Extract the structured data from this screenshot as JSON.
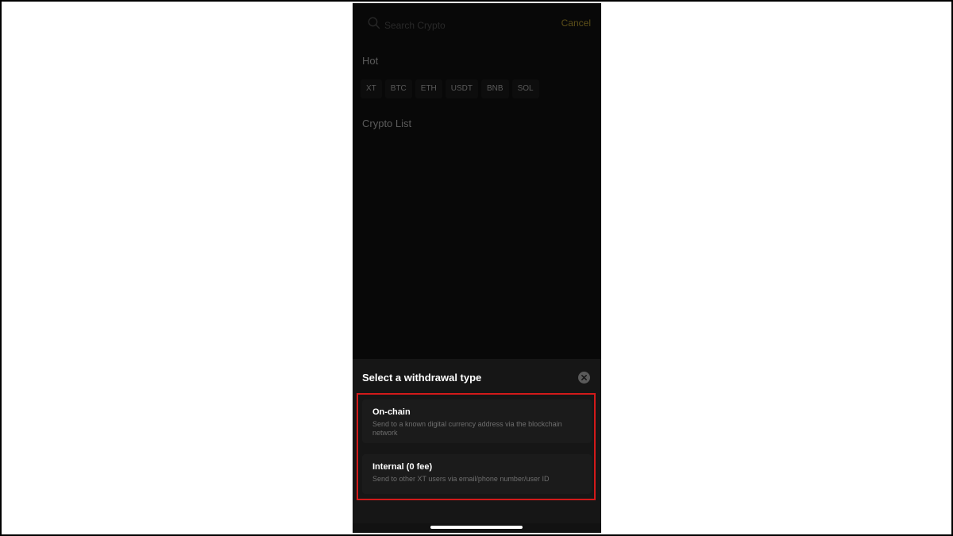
{
  "search": {
    "placeholder": "Search Crypto",
    "cancel_label": "Cancel"
  },
  "hot": {
    "title": "Hot",
    "chips": [
      "XT",
      "BTC",
      "ETH",
      "USDT",
      "BNB",
      "SOL"
    ]
  },
  "crypto_list": {
    "title": "Crypto List"
  },
  "sheet": {
    "title": "Select a withdrawal type",
    "options": [
      {
        "title": "On-chain",
        "description": "Send to a known digital currency address via the blockchain network"
      },
      {
        "title": "Internal (0 fee)",
        "description": "Send to other XT users via email/phone number/user ID"
      }
    ]
  },
  "colors": {
    "accent": "#8e7a27",
    "highlight_border": "#d21a1a",
    "background": "#0d0d0d"
  },
  "icons": {
    "search": "search-icon",
    "close": "close-icon"
  }
}
